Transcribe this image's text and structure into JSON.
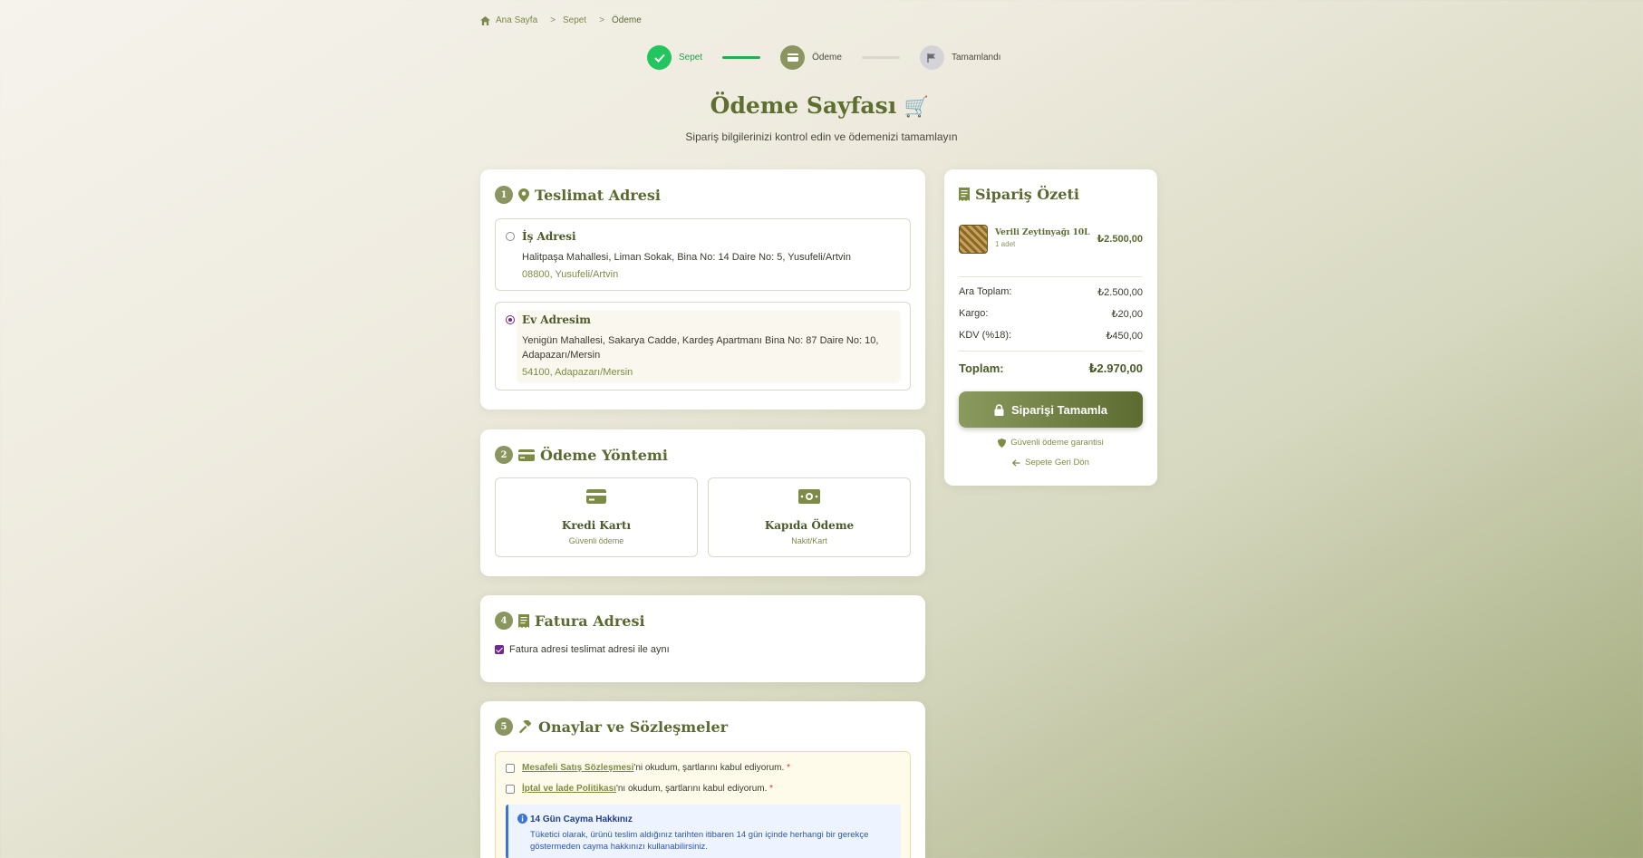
{
  "breadcrumb": {
    "home": "Ana Sayfa",
    "cart": "Sepet",
    "current": "Ödeme"
  },
  "stepper": [
    {
      "label": "Sepet",
      "state": "done"
    },
    {
      "label": "Ödeme",
      "state": "active"
    },
    {
      "label": "Tamamlandı",
      "state": "pending"
    }
  ],
  "header": {
    "title": "Ödeme Sayfası",
    "title_emoji": "🛒",
    "subtitle": "Sipariş bilgilerinizi kontrol edin ve ödemenizi tamamlayın"
  },
  "delivery": {
    "number": "1",
    "title": "Teslimat Adresi",
    "addresses": [
      {
        "name": "İş Adresi",
        "line": "Halitpaşa Mahallesi, Liman Sokak, Bina No: 14 Daire No: 5, Yusufeli/Artvin",
        "zip_city": "08800, Yusufeli/Artvin",
        "selected": false
      },
      {
        "name": "Ev Adresim",
        "line": "Yenigün Mahallesi, Sakarya Cadde, Kardeş Apartmanı Bina No: 87 Daire No: 10, Adapazarı/Mersin",
        "zip_city": "54100, Adapazarı/Mersin",
        "selected": true
      }
    ]
  },
  "payment": {
    "number": "2",
    "title": "Ödeme Yöntemi",
    "methods": [
      {
        "title": "Kredi Kartı",
        "subtitle": "Güvenli ödeme",
        "icon": "credit-card-icon"
      },
      {
        "title": "Kapıda Ödeme",
        "subtitle": "Nakit/Kart",
        "icon": "cash-icon"
      }
    ]
  },
  "billing": {
    "number": "4",
    "title": "Fatura Adresi",
    "same_label": "Fatura adresi teslimat adresi ile aynı",
    "same_checked": true
  },
  "agreements": {
    "number": "5",
    "title": "Onaylar ve Sözleşmeler",
    "items": [
      {
        "link": "Mesafeli Satış Sözleşmesi",
        "text": "'ni okudum, şartlarını kabul ediyorum.",
        "required": "*"
      },
      {
        "link": "İptal ve İade Politikası",
        "text": "'nı okudum, şartlarını kabul ediyorum.",
        "required": "*"
      }
    ],
    "info_title": "14 Gün Cayma Hakkınız",
    "info_text": "Tüketici olarak, ürünü teslim aldığınız tarihten itibaren 14 gün içinde herhangi bir gerekçe göstermeden cayma hakkınızı kullanabilirsiniz."
  },
  "summary": {
    "title": "Sipariş Özeti",
    "product": {
      "name": "Verili Zeytinyağı 10L",
      "qty": "1 adet",
      "price": "₺2.500,00"
    },
    "rows": [
      {
        "label": "Ara Toplam:",
        "value": "₺2.500,00"
      },
      {
        "label": "Kargo:",
        "value": "₺20,00"
      },
      {
        "label": "KDV (%18):",
        "value": "₺450,00"
      }
    ],
    "total_label": "Toplam:",
    "total_value": "₺2.970,00",
    "complete_button": "Siparişi Tamamla",
    "secure_text": "Güvenli ödeme garantisi",
    "back_text": "Sepete Geri Dön"
  },
  "colors": {
    "accent": "#5e6f32",
    "success": "#22c55e",
    "radio_selected": "#6a2b8a",
    "info": "#3b73d6"
  }
}
